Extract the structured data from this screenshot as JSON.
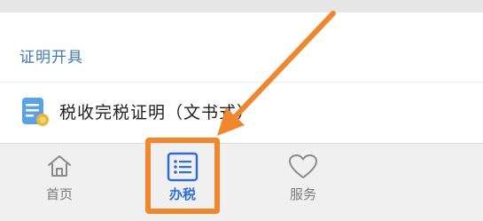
{
  "section": {
    "title": "证明开具"
  },
  "item": {
    "label": "税收完税证明（文书式）",
    "icon": "document-certificate-icon"
  },
  "tabbar": {
    "tabs": [
      {
        "label": "首页",
        "icon": "home-icon",
        "active": false
      },
      {
        "label": "办税",
        "icon": "list-icon",
        "active": true
      },
      {
        "label": "服务",
        "icon": "heart-icon",
        "active": false
      }
    ]
  },
  "annotation": {
    "color": "#f0872c",
    "type": "arrow-pointing-to-tab"
  },
  "colors": {
    "accent": "#2f6fd1",
    "section_title": "#3f78b8",
    "annotation": "#f0872c"
  }
}
